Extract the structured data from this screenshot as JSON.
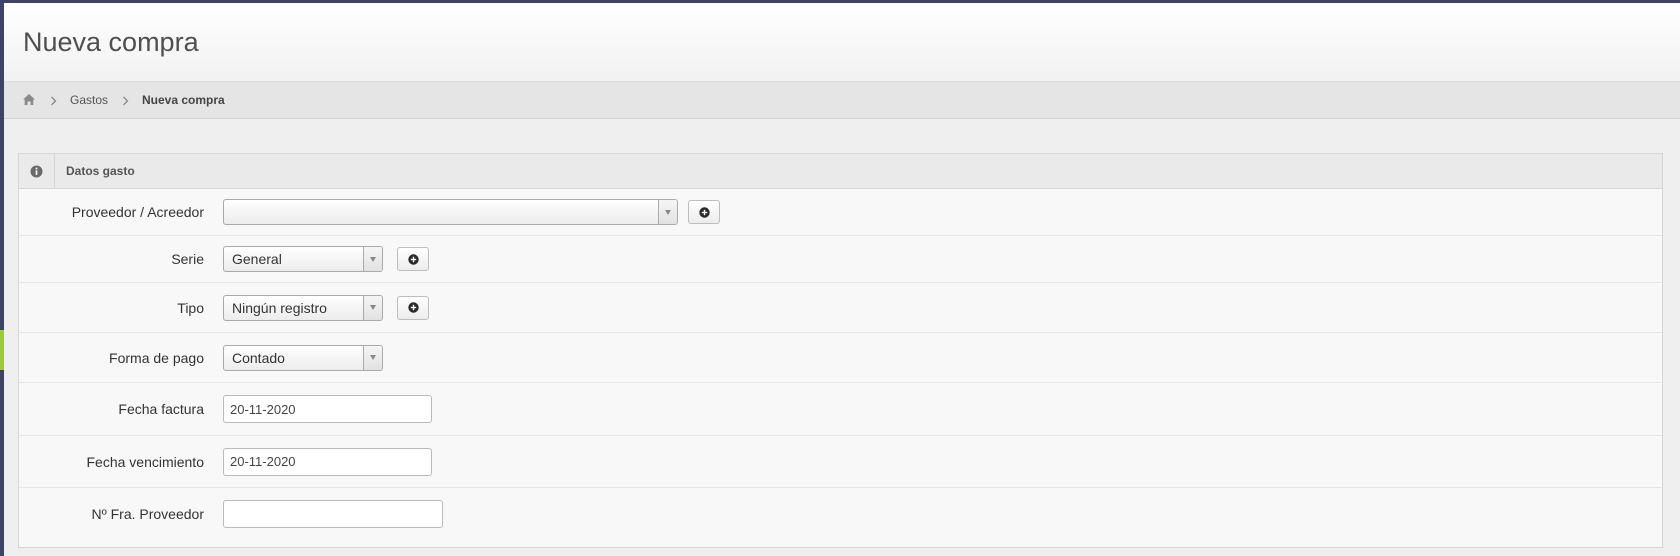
{
  "page": {
    "title": "Nueva compra"
  },
  "breadcrumb": {
    "items": [
      "Gastos",
      "Nueva compra"
    ]
  },
  "panel": {
    "heading": "Datos gasto",
    "fields": {
      "proveedor": {
        "label": "Proveedor / Acreedor",
        "value": ""
      },
      "serie": {
        "label": "Serie",
        "value": "General"
      },
      "tipo": {
        "label": "Tipo",
        "value": "Ningún registro"
      },
      "forma_pago": {
        "label": "Forma de pago",
        "value": "Contado"
      },
      "fecha_factura": {
        "label": "Fecha factura",
        "value": "20-11-2020"
      },
      "fecha_vencimiento": {
        "label": "Fecha vencimiento",
        "value": "20-11-2020"
      },
      "num_fra": {
        "label": "Nº Fra. Proveedor",
        "value": ""
      }
    }
  },
  "icons": {
    "home": "home-icon",
    "info": "info-circle-icon",
    "add": "plus-circle-icon",
    "chevron": "chevron-right-icon"
  },
  "colors": {
    "sidebar": "#3d4466",
    "accent": "#9ac93a",
    "background": "#efefef"
  }
}
